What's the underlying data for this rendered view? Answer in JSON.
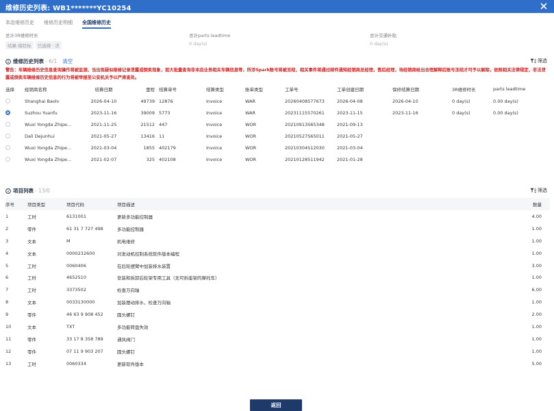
{
  "window": {
    "title": "维修历史列表: WB1*******YC10254"
  },
  "tabs": [
    {
      "label": "本店维修历史"
    },
    {
      "label": "维修历史明细"
    },
    {
      "label": "全国维修历史"
    }
  ],
  "kpis": [
    {
      "label": "总计3R维修时长",
      "value": "",
      "pills": [
        "结果:保险标",
        "已选择 · 次"
      ]
    },
    {
      "label": "总计parts leadtime",
      "value": "0 day(s)"
    },
    {
      "label": "总计交通补贴",
      "value": "0 day(s)"
    }
  ],
  "history": {
    "title": "维修历史列表",
    "count": "- 6/1",
    "clear": "清空",
    "filter": "筛选",
    "warning": "警告：车辆维修历史信息查询操作将被监测，当出现疑似维修记录泄露或倒卖现象，如大批量查询非本店业务相关车辆信息等，所涉Spark账号将被冻结，相关事件将通过邮件通知经销商总经理，售后经理，待经销商给出合理解释后账号冻结才可予以解除，依照相关法律规定，非法泄露或倒卖车辆维修历史信息的行为将被举报至公安机关予以严肃查处。",
    "columns": [
      "选择",
      "经销商名称",
      "结算日期",
      "里程",
      "结算单号",
      "结算类型",
      "账单类型",
      "工单号",
      "工单创建日期",
      "保修结算日期",
      "3R维修时长",
      "parts leadtime"
    ],
    "rows": [
      {
        "selected": false,
        "cells": [
          "Shanghai Baolv",
          "2026-04-10",
          "49739",
          "12876",
          "Invoice",
          "WAR",
          "20260408577673",
          "2026-04-08",
          "2026-04-10",
          "0 day(s)",
          "0.00 day(s)"
        ]
      },
      {
        "selected": true,
        "cells": [
          "Suzhou Yuanfu",
          "2023-11-16",
          "39009",
          "5773",
          "Invoice",
          "WAR",
          "20231115570261",
          "2023-11-15",
          "2023-11-16",
          "0 day(s)",
          "0.00 day(s)"
        ]
      },
      {
        "selected": false,
        "cells": [
          "Wuxi Yongda Zhipe...",
          "2021-11-25",
          "21512",
          "447",
          "Invoice",
          "WOR",
          "20210913S65348",
          "2021-09-13",
          "",
          "",
          ""
        ]
      },
      {
        "selected": false,
        "cells": [
          "Dali Dejunhui",
          "2021-05-27",
          "13416",
          "11",
          "Invoice",
          "WOR",
          "20210527S65011",
          "2021-05-27",
          "",
          "",
          ""
        ]
      },
      {
        "selected": false,
        "cells": [
          "Wuxi Yongda Zhipe...",
          "2021-03-04",
          "1855",
          "402179",
          "Invoice",
          "WOR",
          "20210304S12030",
          "2021-03-04",
          "",
          "",
          ""
        ]
      },
      {
        "selected": false,
        "cells": [
          "Wuxi Yongda Zhipe...",
          "2021-02-07",
          "325",
          "402108",
          "Invoice",
          "WOR",
          "20210128511942",
          "2021-01-28",
          "",
          "",
          ""
        ]
      }
    ]
  },
  "items": {
    "title": "项目列表",
    "count": "- 13/0",
    "filter": "筛选",
    "columns": [
      "序号",
      "项目类型",
      "项目代码",
      "项目描述",
      "数量"
    ],
    "rows": [
      [
        "1",
        "工时",
        "6131001",
        "更新多功能控制器",
        "4.00"
      ],
      [
        "2",
        "零件",
        "61 31 7 727 498",
        "多功能控制器",
        "1.00"
      ],
      [
        "3",
        "文本",
        "M",
        "机电维修",
        "1.00"
      ],
      [
        "4",
        "文本",
        "0000232600",
        "对发动机控制系统软件版本编程",
        "1.00"
      ],
      [
        "5",
        "工时",
        "0060406",
        "在后轮摆臂中加装排水装置",
        "3.00"
      ],
      [
        "6",
        "工时",
        "4652510",
        "安装和拆卸后轮架专用工具（无可折座架的摩托车）",
        "1.00"
      ],
      [
        "7",
        "工时",
        "3373502",
        "检查万向轴",
        "6.00"
      ],
      [
        "8",
        "文本",
        "0033130000",
        "加装摆动排水，检查万向轴",
        "1.00"
      ],
      [
        "9",
        "零件",
        "46 63 9 908 452",
        "圆头螺钉",
        "2.00"
      ],
      [
        "10",
        "文本",
        "TXT",
        "多功能转盘失效",
        "1.00"
      ],
      [
        "11",
        "零件",
        "33 17 8 358 789",
        "通风阀门",
        "1.00"
      ],
      [
        "12",
        "零件",
        "07 11 9 903 207",
        "圆头螺钉",
        "1.00"
      ],
      [
        "13",
        "工时",
        "0060334",
        "更新软件版本",
        "5.00"
      ]
    ]
  },
  "footer": {
    "back_label": "返回"
  }
}
